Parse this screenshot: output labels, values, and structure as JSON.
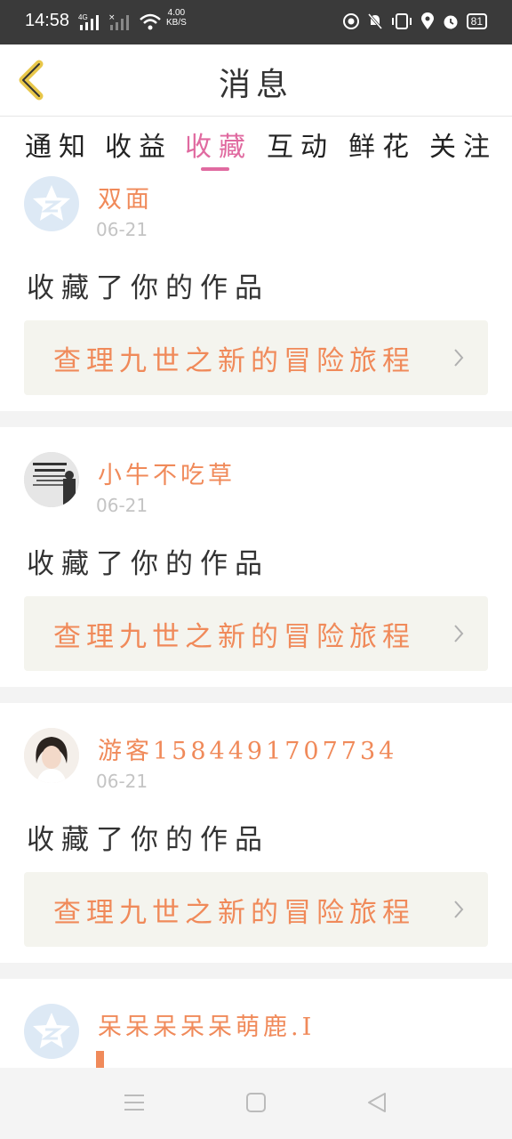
{
  "status_bar": {
    "time": "14:58",
    "network": "4G",
    "speed_value": "4.00",
    "speed_unit": "KB/S",
    "battery": "81"
  },
  "header": {
    "title": "消息",
    "back_icon": "chevron-left-icon"
  },
  "tabs": [
    {
      "label": "通知",
      "active": false
    },
    {
      "label": "收益",
      "active": false
    },
    {
      "label": "收藏",
      "active": true
    },
    {
      "label": "互动",
      "active": false
    },
    {
      "label": "鲜花",
      "active": false
    },
    {
      "label": "关注",
      "active": false
    }
  ],
  "messages": [
    {
      "username": "双面",
      "date": "06-21",
      "action": "收藏了你的作品",
      "work": "查理九世之新的冒险旅程",
      "avatar": "default-avatar"
    },
    {
      "username": "小牛不吃草",
      "date": "06-21",
      "action": "收藏了你的作品",
      "work": "查理九世之新的冒险旅程",
      "avatar": "photo-avatar"
    },
    {
      "username": "游客15844917077​34",
      "date": "06-21",
      "action": "收藏了你的作品",
      "work": "查理九世之新的冒险旅程",
      "avatar": "photo-avatar"
    },
    {
      "username": "呆呆呆呆呆萌鹿.I",
      "avatar": "default-avatar"
    }
  ],
  "colors": {
    "accent": "#e06aa0",
    "username": "#f08a5a",
    "work_bg": "#f4f4ee",
    "status_bg": "#3a3a3a"
  }
}
